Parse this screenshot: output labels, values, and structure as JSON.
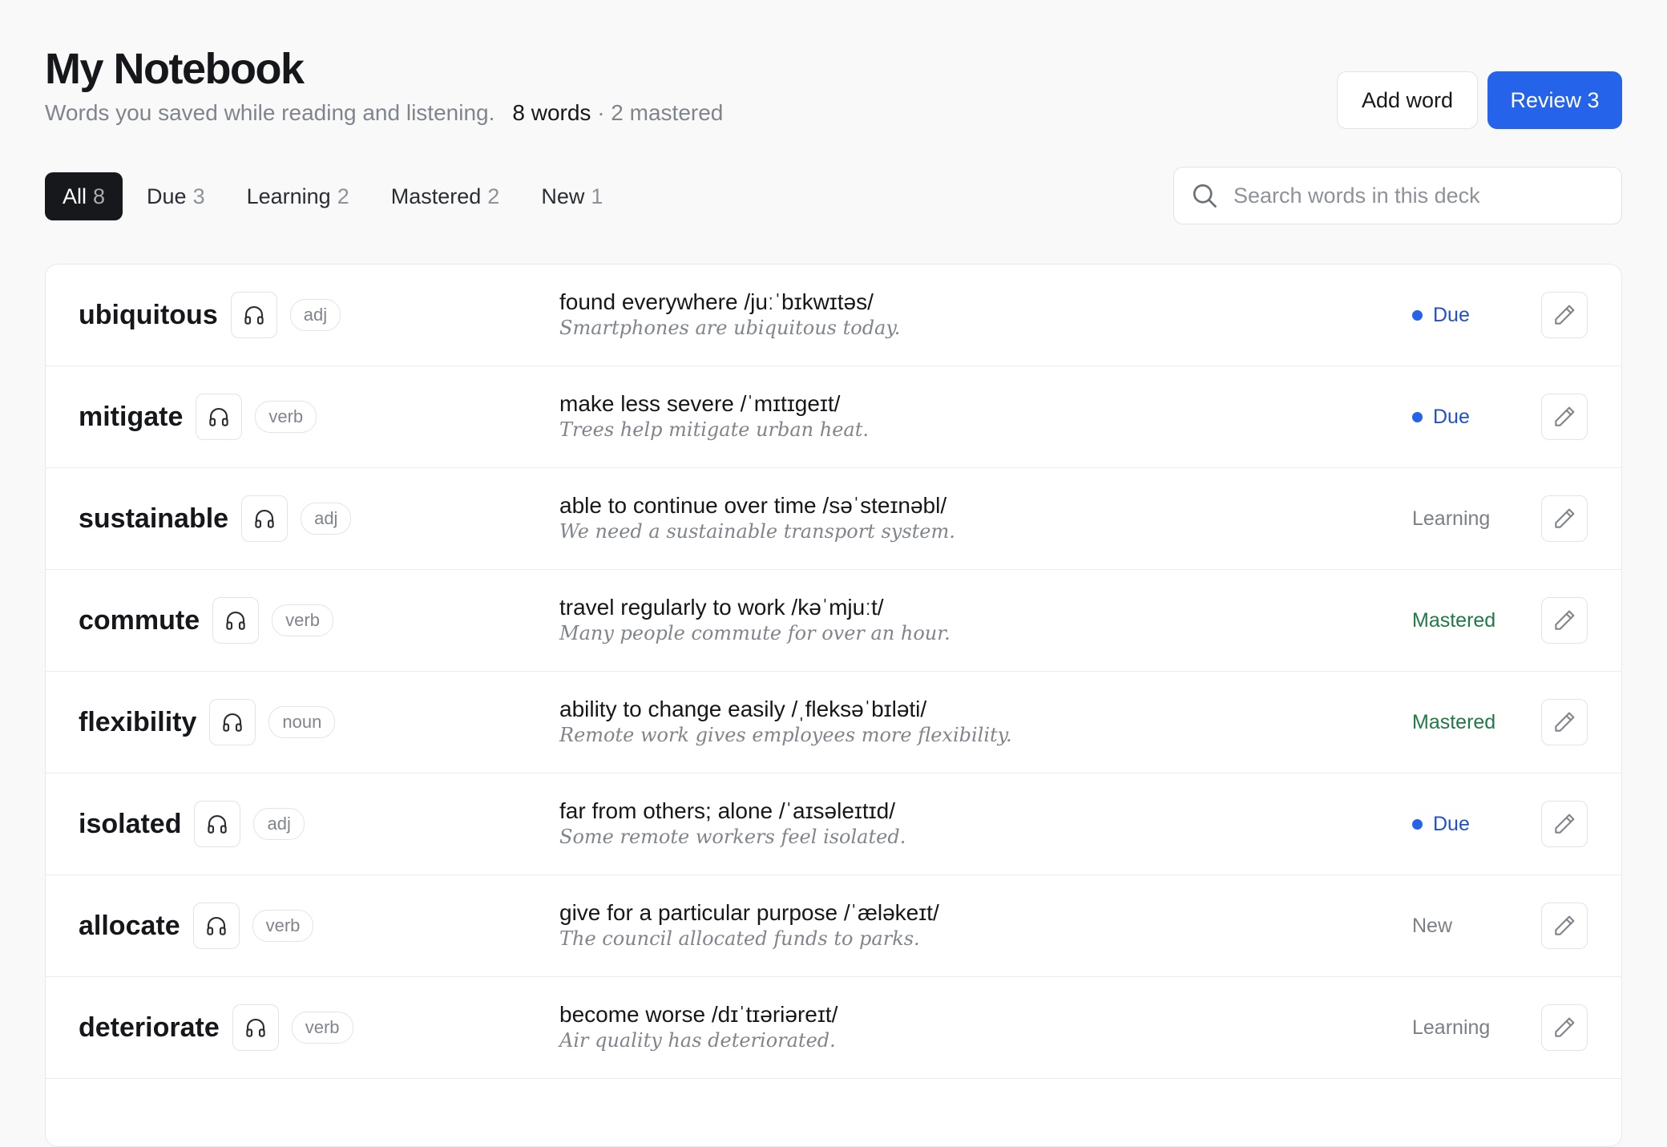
{
  "header": {
    "title": "My Notebook",
    "subtitle": "Words you saved while reading and listening.",
    "word_count": "8 words",
    "mastered_count": "· 2 mastered",
    "add_word_label": "Add word",
    "review_label": "Review 3"
  },
  "tabs": [
    {
      "label": "All",
      "count": "8",
      "active": true
    },
    {
      "label": "Due",
      "count": "3"
    },
    {
      "label": "Learning",
      "count": "2"
    },
    {
      "label": "Mastered",
      "count": "2"
    },
    {
      "label": "New",
      "count": "1"
    }
  ],
  "search": {
    "placeholder": "Search words in this deck",
    "icon": "search-icon"
  },
  "words": [
    {
      "word": "ubiquitous",
      "pos": "adj",
      "definition": "found everywhere /juːˈbɪkwɪtəs/",
      "example": "Smartphones are ubiquitous today.",
      "status": "Due"
    },
    {
      "word": "mitigate",
      "pos": "verb",
      "definition": "make less severe /ˈmɪtɪɡeɪt/",
      "example": "Trees help mitigate urban heat.",
      "status": "Due"
    },
    {
      "word": "sustainable",
      "pos": "adj",
      "definition": "able to continue over time /səˈsteɪnəbl/",
      "example": "We need a sustainable transport system.",
      "status": "Learning"
    },
    {
      "word": "commute",
      "pos": "verb",
      "definition": "travel regularly to work /kəˈmjuːt/",
      "example": "Many people commute for over an hour.",
      "status": "Mastered"
    },
    {
      "word": "flexibility",
      "pos": "noun",
      "definition": "ability to change easily /ˌfleksəˈbɪləti/",
      "example": "Remote work gives employees more flexibility.",
      "status": "Mastered"
    },
    {
      "word": "isolated",
      "pos": "adj",
      "definition": "far from others; alone /ˈaɪsəleɪtɪd/",
      "example": "Some remote workers feel isolated.",
      "status": "Due"
    },
    {
      "word": "allocate",
      "pos": "verb",
      "definition": "give for a particular purpose /ˈæləkeɪt/",
      "example": "The council allocated funds to parks.",
      "status": "New"
    },
    {
      "word": "deteriorate",
      "pos": "verb",
      "definition": "become worse /dɪˈtɪəriəreɪt/",
      "example": "Air quality has deteriorated.",
      "status": "Learning"
    }
  ],
  "colors": {
    "accent": "#2563eb",
    "due": "#2150c9",
    "mastered": "#1f7a45",
    "muted": "#7b8087"
  },
  "icons": {
    "audio": "headphones-icon",
    "edit": "pencil-icon"
  }
}
